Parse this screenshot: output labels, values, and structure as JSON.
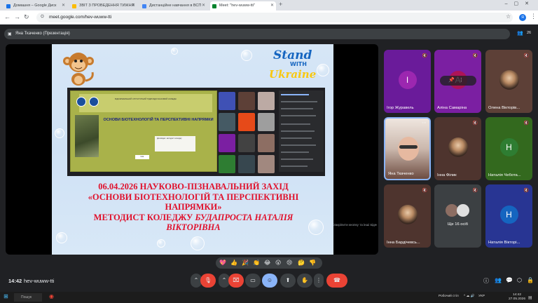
{
  "browser": {
    "tabs": [
      {
        "title": "Домашня – Google Диск",
        "color": "#1a73e8"
      },
      {
        "title": "ЗВІТ З ПРОВЕДЕННЯ ТИЖНЯ",
        "color": "#fbbc04"
      },
      {
        "title": "Дистанційне навчання в ВСП",
        "color": "#4285f4"
      },
      {
        "title": "Meet: \"hev-wuww-tti\"",
        "color": "#00832d"
      }
    ],
    "new_tab": "+",
    "url": "meet.google.com/hev-wuww-tti",
    "profile_initial": "Я"
  },
  "meet": {
    "presenting_label": "Яна Ткаченко (Презентація)",
    "people_count": "26",
    "side_hint": "Закріпити кнопку та інші відео, щоб відображати їх в рядок",
    "slide": {
      "stand_line1": "Stand",
      "stand_line2": "WITH",
      "stand_line3": "Ukraine",
      "inner_title": "ОСНОВИ БІОТЕХНОЛОГІЙ ТА ПЕРСПЕКТИВНІ НАПРЯМКИ",
      "inner_header": "ВІДОКРЕМЛЕНИЙ СТРУКТУРНИЙ ПІДРОЗДІЛ ФАХОВИЙ КОЛЕДЖ",
      "inner_doc": "Доповідач: методист коледжу",
      "inner_small": "Київ",
      "line1": "06.04.2026 НАУКОВО-ПІЗНАВАЛЬНИЙ ЗАХІД",
      "line2": "«ОСНОВИ БІОТЕХНОЛОГІЙ ТА ПЕРСПЕКТИВНІ",
      "line3": "НАПРЯМКИ»",
      "line4a": "МЕТОДИСТ КОЛЕДЖУ ",
      "line4b": "БУДАПРОСТА НАТАЛІЯ",
      "line5": "ВІКТОРІВНА"
    },
    "participants": [
      {
        "name": "Ігор Журавель",
        "type": "initial",
        "initial": "І",
        "bg": "#9c27b0",
        "tile_bg": "#6a1b9a"
      },
      {
        "name": "Аліна Самаріна",
        "type": "initial",
        "initial": "А",
        "bg": "#ad1457",
        "tile_bg": "#7b1fa2"
      },
      {
        "name": "Олена Вікторів...",
        "type": "photo",
        "tile_bg": "#5d4037"
      },
      {
        "name": "Яна Ткаченко",
        "type": "video",
        "tile_bg": "#d7ccc8"
      },
      {
        "name": "Інна Філик",
        "type": "photo",
        "tile_bg": "#4e342e"
      },
      {
        "name": "Наталія Чебота...",
        "type": "initial",
        "initial": "Н",
        "bg": "#2e7d32",
        "tile_bg": "#33691e"
      },
      {
        "name": "Інна Бардічевсь...",
        "type": "photo",
        "tile_bg": "#4e342e"
      },
      {
        "name": "Ще 16 осіб",
        "type": "more",
        "tile_bg": "#3c4043"
      },
      {
        "name": "Наталія Вікторі...",
        "type": "initial",
        "initial": "Н",
        "bg": "#1565c0",
        "tile_bg": "#283593"
      }
    ],
    "reactions": [
      "💖",
      "👍",
      "🎉",
      "👏",
      "😂",
      "😮",
      "😢",
      "🤔",
      "👎"
    ],
    "clock": "14:42",
    "meeting_code": "hev-wuww-tti"
  },
  "taskbar": {
    "search_hint": "Пошук",
    "tray_text": "Робочий стіл",
    "lang": "УКР",
    "time": "14:42",
    "date": "27.05.2026"
  }
}
